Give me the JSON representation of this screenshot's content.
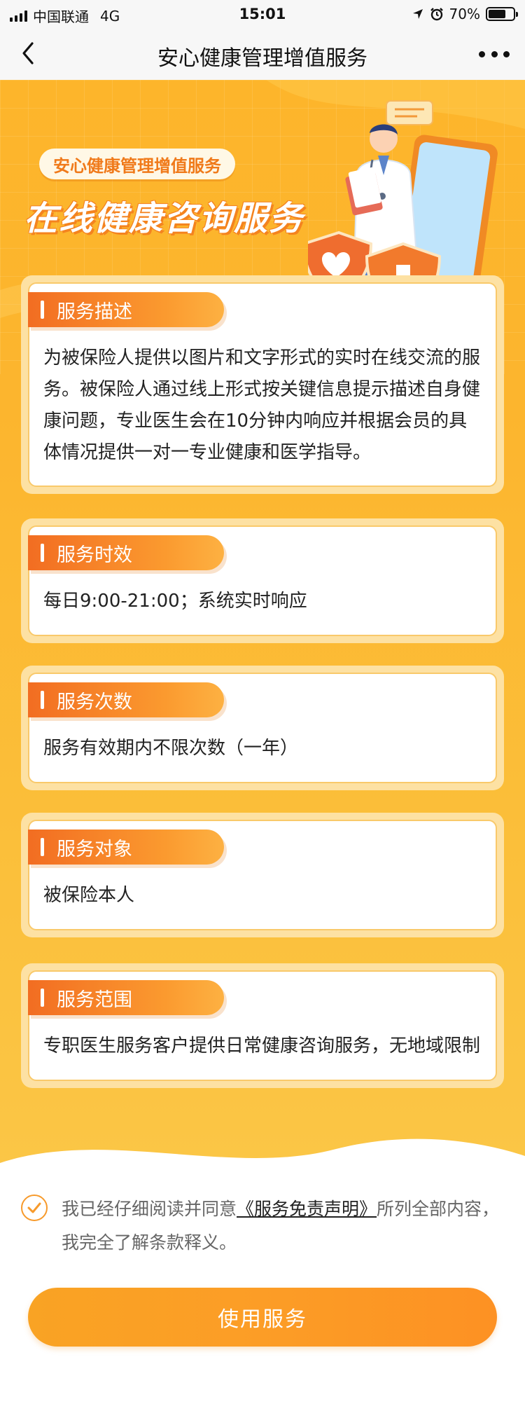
{
  "status_bar": {
    "carrier": "中国联通",
    "network": "4G",
    "time": "15:01",
    "battery": "70%",
    "battery_level": 0.7,
    "icons": [
      "signal-icon",
      "location-icon",
      "alarm-icon",
      "battery-icon"
    ]
  },
  "nav": {
    "title": "安心健康管理增值服务",
    "back_icon": "back-arrow-icon",
    "more_icon": "more-icon"
  },
  "hero": {
    "tag": "安心健康管理增值服务",
    "title": "在线健康咨询服务",
    "illustration": "doctor-phone-illustration"
  },
  "cards": [
    {
      "title": "服务描述",
      "body": "为被保险人提供以图片和文字形式的实时在线交流的服务。被保险人通过线上形式按关键信息提示描述自身健康问题，专业医生会在10分钟内响应并根据会员的具体情况提供一对一专业健康和医学指导。"
    },
    {
      "title": "服务时效",
      "body": "每日9:00-21:00；系统实时响应"
    },
    {
      "title": "服务次数",
      "body": "服务有效期内不限次数（一年）"
    },
    {
      "title": "服务对象",
      "body": "被保险本人"
    },
    {
      "title": "服务范围",
      "body": "专职医生服务客户提供日常健康咨询服务，无地域限制"
    }
  ],
  "agreement": {
    "checked": true,
    "prefix": "我已经仔细阅读并同意",
    "link": "《服务免责声明》",
    "suffix": "所列全部内容，我完全了解条款释义。"
  },
  "button": {
    "label": "使用服务"
  },
  "colors": {
    "hero_orange": "#fdb52b",
    "tab_orange": "#f26d22",
    "button_orange": "#fc9d26",
    "card_border": "#f9c96a"
  }
}
